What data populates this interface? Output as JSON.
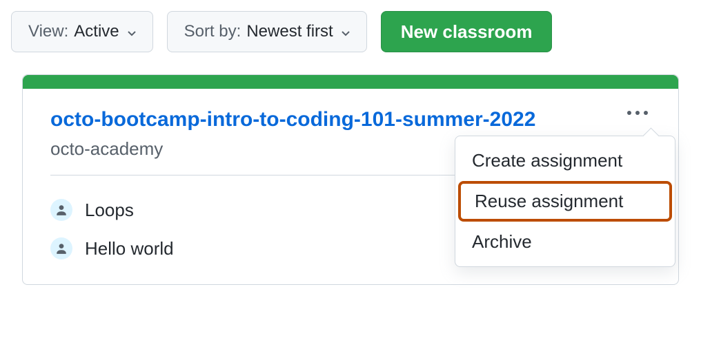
{
  "toolbar": {
    "view": {
      "label": "View:",
      "selected": "Active"
    },
    "sort": {
      "label": "Sort by:",
      "selected": "Newest first"
    },
    "new_button": "New classroom"
  },
  "classroom": {
    "title": "octo-bootcamp-intro-to-coding-101-summer-2022",
    "org": "octo-academy",
    "assignments": [
      {
        "name": "Loops"
      },
      {
        "name": "Hello world"
      }
    ]
  },
  "menu": {
    "items": [
      {
        "label": "Create assignment",
        "highlighted": false
      },
      {
        "label": "Reuse assignment",
        "highlighted": true
      },
      {
        "label": "Archive",
        "highlighted": false
      }
    ]
  }
}
